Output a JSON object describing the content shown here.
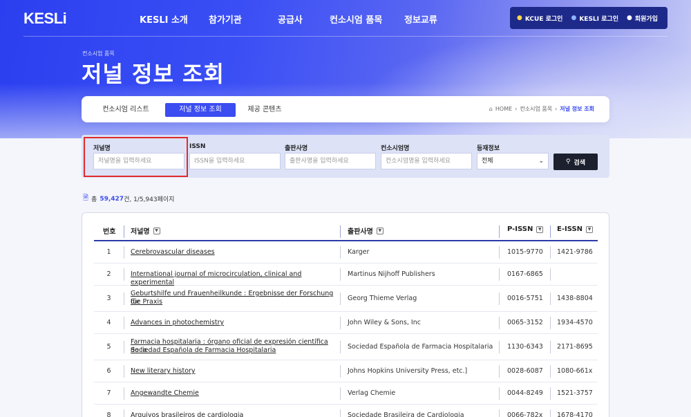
{
  "header": {
    "logo": "KESLi",
    "nav": [
      "KESLI 소개",
      "참가기관",
      "공급사",
      "컨소시엄 품목",
      "정보교류"
    ],
    "auth": {
      "kcue_login": "KCUE 로그인",
      "kesli_login": "KESLI 로그인",
      "signup": "회원가입"
    }
  },
  "hero": {
    "category": "컨소시엄 품목",
    "title": "저널 정보 조회"
  },
  "tabs": [
    "컨소시엄 리스트",
    "저널 정보 조회",
    "제공 콘텐츠"
  ],
  "active_tab": "저널 정보 조회",
  "breadcrumb": {
    "home": "HOME",
    "level1": "컨소시엄 품목",
    "current": "저널 정보 조회"
  },
  "search": {
    "fields": [
      {
        "label": "저널명",
        "placeholder": "저널명을 입력하세요"
      },
      {
        "label": "ISSN",
        "placeholder": "ISSN을 입력하세요"
      },
      {
        "label": "출판사명",
        "placeholder": "출판사명을 입력하세요"
      },
      {
        "label": "컨소시엄명",
        "placeholder": "컨소시엄명을 입력하세요"
      }
    ],
    "status": {
      "label": "등재정보",
      "value": "전체"
    },
    "button": "검색"
  },
  "summary": {
    "prefix": "총",
    "total": "59,427",
    "suffix": "건, 1/5,943페이지"
  },
  "table": {
    "columns": [
      "번호",
      "저널명",
      "출판사명",
      "P-ISSN",
      "E-ISSN"
    ],
    "rows": [
      {
        "no": "1",
        "title": "Cerebrovascular diseases",
        "title2": "",
        "publisher": "Karger",
        "pissn": "1015-9770",
        "eissn": "1421-9786"
      },
      {
        "no": "2",
        "title": "International journal of microcirculation, clinical and experimental",
        "title2": "",
        "publisher": "Martinus Nijhoff Publishers",
        "pissn": "0167-6865",
        "eissn": ""
      },
      {
        "no": "3",
        "title": "Geburtshilfe und Frauenheilkunde : Ergebnisse der Forschung für",
        "title2": "die Praxis",
        "publisher": "Georg Thieme Verlag",
        "pissn": "0016-5751",
        "eissn": "1438-8804"
      },
      {
        "no": "4",
        "title": "Advances in photochemistry",
        "title2": "",
        "publisher": "John Wiley & Sons, Inc",
        "pissn": "0065-3152",
        "eissn": "1934-4570"
      },
      {
        "no": "5",
        "title": "Farmacia hospitalaria : órgano oficial de expresión científica de la",
        "title2": "Sociedad Española de Farmacia Hospitalaria",
        "publisher": "Sociedad Española de Farmacia Hospitalaria",
        "pissn": "1130-6343",
        "eissn": "2171-8695"
      },
      {
        "no": "6",
        "title": "New literary history",
        "title2": "",
        "publisher": "Johns Hopkins University Press, etc.]",
        "pissn": "0028-6087",
        "eissn": "1080-661x"
      },
      {
        "no": "7",
        "title": "Angewandte Chemie",
        "title2": "",
        "publisher": "Verlag Chemie",
        "pissn": "0044-8249",
        "eissn": "1521-3757"
      },
      {
        "no": "8",
        "title": "Arquivos brasileiros de cardiologia",
        "title2": "",
        "publisher": "Sociedade Brasileira de Cardiologia",
        "pissn": "0066-782x",
        "eissn": "1678-4170"
      }
    ]
  }
}
